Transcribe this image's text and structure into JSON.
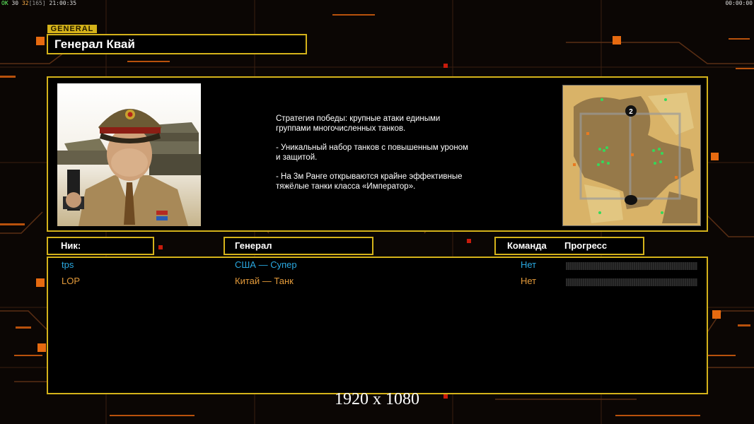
{
  "hud": {
    "ok_label": "OK",
    "val1": "30",
    "val2": "32",
    "val3": "[165]",
    "time_left": "21:00:35",
    "time_right": "00:00:00"
  },
  "header": {
    "tag": "GENERAL",
    "title": "Генерал Квай"
  },
  "description": {
    "paragraphs": [
      "Стратегия победы: крупные атаки едиными\n группами многочисленных танков.",
      "- Уникальный набор танков с повышенным уроном\n и защитой.",
      "- На 3м Ранге открываются крайне эффективные\n тяжёлые танки класса «Император»."
    ]
  },
  "minimap": {
    "marker_2": "2"
  },
  "table": {
    "col_nick": "Ник:",
    "col_general": "Генерал",
    "col_team": "Команда",
    "col_progress": "Прогресс",
    "rows": [
      {
        "nick": "tps",
        "general": "США — Супер",
        "team": "Нет",
        "color": "#2aa8e0"
      },
      {
        "nick": "LOP",
        "general": "Китай — Танк",
        "team": "Нет",
        "color": "#e39a3a"
      }
    ]
  },
  "footer": {
    "resolution": "1920 x 1080"
  },
  "colors": {
    "accent": "#d4b21a",
    "glow": "#e66a10"
  }
}
